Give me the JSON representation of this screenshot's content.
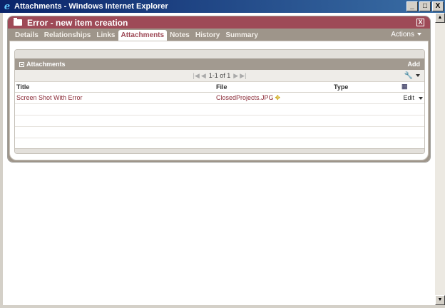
{
  "window": {
    "title": "Attachments - Windows Internet Explorer",
    "buttons": {
      "minimize": "_",
      "maximize": "□",
      "close": "X"
    }
  },
  "dialog": {
    "title": "Error - new item creation",
    "close": "X"
  },
  "tabs": [
    {
      "label": "Details",
      "active": false
    },
    {
      "label": "Relationships",
      "active": false
    },
    {
      "label": "Links",
      "active": false
    },
    {
      "label": "Attachments",
      "active": true
    },
    {
      "label": "Notes",
      "active": false
    },
    {
      "label": "History",
      "active": false
    },
    {
      "label": "Summary",
      "active": false
    }
  ],
  "actions_label": "Actions",
  "section": {
    "title": "Attachments",
    "add_label": "Add"
  },
  "pager": {
    "text": "1-1 of 1"
  },
  "table": {
    "columns": [
      "Title",
      "File",
      "Type"
    ],
    "rows": [
      {
        "title": "Screen Shot With Error",
        "file": "ClosedProjects.JPG",
        "type": "",
        "action": "Edit"
      }
    ]
  },
  "colors": {
    "header": "#9e4a57",
    "tabbar": "#9e958a",
    "link": "#8a2a36"
  }
}
